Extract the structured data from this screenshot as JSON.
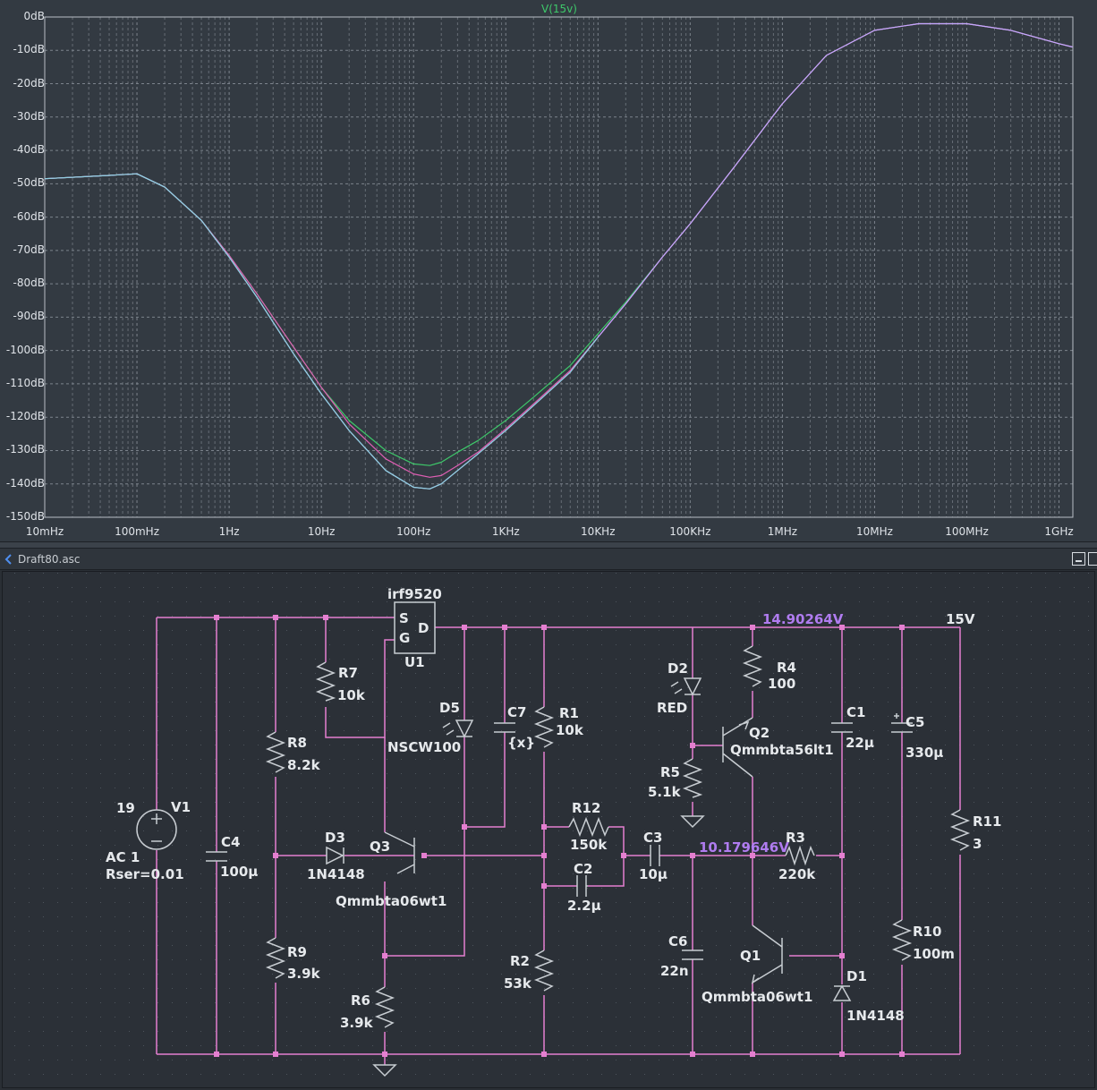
{
  "plot": {
    "trace_label": "V(15v)",
    "trace_color": "#3ec86a",
    "y_axis": {
      "ticks": [
        "0dB",
        "-10dB",
        "-20dB",
        "-30dB",
        "-40dB",
        "-50dB",
        "-60dB",
        "-70dB",
        "-80dB",
        "-90dB",
        "-100dB",
        "-110dB",
        "-120dB",
        "-130dB",
        "-140dB",
        "-150dB"
      ],
      "range_db": [
        -150,
        0
      ]
    },
    "x_axis": {
      "ticks": [
        "10mHz",
        "100mHz",
        "1Hz",
        "10Hz",
        "100Hz",
        "1KHz",
        "10KHz",
        "100KHz",
        "1MHz",
        "10MHz",
        "100MHz",
        "1GHz"
      ],
      "range_log10_hz": [
        -2,
        9.15
      ],
      "scale": "log"
    },
    "grid": true,
    "background": "#333a42",
    "grid_color": "#7c838c"
  },
  "chart_data": {
    "type": "line",
    "title": "",
    "xlabel": "",
    "ylabel": "",
    "x_scale": "log",
    "x_unit": "Hz",
    "y_unit": "dB",
    "ylim": [
      -150,
      0
    ],
    "xlim": [
      0.01,
      1400000000
    ],
    "grid": true,
    "series": [
      {
        "name": "V(15v)",
        "color": "#3ec86a",
        "x": [
          0.01,
          0.05,
          0.1,
          0.2,
          0.5,
          1,
          2,
          5,
          10,
          20,
          50,
          100,
          150,
          200,
          300,
          500,
          1000,
          2000,
          5000,
          10000,
          20000,
          50000,
          100000,
          300000,
          1000000,
          3000000,
          10000000,
          30000000,
          100000000,
          300000000,
          1000000000,
          1400000000
        ],
        "y": [
          -48.5,
          -47.5,
          -47,
          -51,
          -61,
          -71.5,
          -83,
          -99,
          -111,
          -121,
          -130,
          -134,
          -134.5,
          -133.5,
          -130.5,
          -127,
          -121,
          -114,
          -104.5,
          -95,
          -85.5,
          -72,
          -62,
          -45,
          -26,
          -11.5,
          -4,
          -2,
          -2,
          -4,
          -8,
          -9
        ]
      },
      {
        "name": "",
        "color": "#e05fb4",
        "x": [
          0.01,
          0.05,
          0.1,
          0.2,
          0.5,
          1,
          2,
          5,
          10,
          20,
          50,
          100,
          150,
          200,
          300,
          500,
          1000,
          2000,
          5000,
          10000,
          20000,
          50000,
          100000,
          300000,
          1000000,
          3000000,
          10000000,
          30000000,
          100000000,
          300000000,
          1000000000,
          1400000000
        ],
        "y": [
          -48.5,
          -47.5,
          -47,
          -51,
          -61,
          -71.5,
          -83,
          -99,
          -111,
          -122,
          -132.5,
          -137,
          -138,
          -137.5,
          -134.5,
          -130.5,
          -123.5,
          -116,
          -106,
          -96,
          -86,
          -72,
          -62,
          -45,
          -26,
          -11.5,
          -4,
          -2,
          -2,
          -4,
          -8,
          -9
        ]
      },
      {
        "name": "",
        "color": "#c4a6ff",
        "x": [
          0.01,
          0.05,
          0.1,
          0.2,
          0.5,
          1,
          2,
          5,
          10,
          20,
          50,
          100,
          150,
          200,
          300,
          500,
          1000,
          2000,
          5000,
          10000,
          20000,
          50000,
          100000,
          300000,
          1000000,
          3000000,
          10000000,
          30000000,
          100000000,
          300000000,
          1000000000,
          1400000000
        ],
        "y": [
          -48.5,
          -47.5,
          -47,
          -51,
          -61,
          -72,
          -84,
          -101,
          -113,
          -124,
          -136,
          -141,
          -141.5,
          -140,
          -136,
          -131,
          -124,
          -116.5,
          -106.5,
          -96,
          -86,
          -72,
          -62,
          -45,
          -26,
          -11.5,
          -4,
          -2,
          -2,
          -4,
          -8,
          -9
        ]
      },
      {
        "name": "",
        "color": "#8fd0e0",
        "x": [
          0.01,
          0.05,
          0.1,
          0.2,
          0.5,
          1,
          2,
          5,
          10,
          20,
          50,
          100,
          150,
          200,
          300,
          500,
          1000,
          2000,
          5000,
          10000
        ],
        "y": [
          -48.5,
          -47.5,
          -47,
          -51,
          -61,
          -72,
          -84,
          -101,
          -113,
          -124,
          -136,
          -141,
          -141.5,
          -140,
          -136,
          -131,
          -124,
          -116.5,
          -106.5,
          -96
        ]
      }
    ]
  },
  "schematic": {
    "window_title": "Draft80.asc",
    "wire_color": "#e47fd0",
    "component_color": "#c8cdd2",
    "labels": {
      "u1_model": "irf9520",
      "u1_ref": "U1",
      "u1_pin_s": "S",
      "u1_pin_g": "G",
      "u1_pin_d": "D",
      "node_top": "14.90264V",
      "node_15v": "15V",
      "node_mid": "10.179646V",
      "d2_ref": "D2",
      "d2_val": "RED",
      "r4_ref": "R4",
      "r4_val": "100",
      "q2_ref": "Q2",
      "q2_val": "Qmmbta56lt1",
      "c1_ref": "C1",
      "c1_val": "22µ",
      "c5_ref": "C5",
      "c5_val": "330µ",
      "r5_ref": "R5",
      "r5_val": "5.1k",
      "r7_ref": "R7",
      "r7_val": "10k",
      "d5_ref": "D5",
      "d5_val": "NSCW100",
      "c7_ref": "C7",
      "c7_val": "{x}",
      "r1_ref": "R1",
      "r1_val": "10k",
      "r8_ref": "R8",
      "r8_val": "8.2k",
      "v1_ref": "V1",
      "v1_dc": "19",
      "v1_ac": "AC 1",
      "v1_rser": "Rser=0.01",
      "c4_ref": "C4",
      "c4_val": "100µ",
      "d3_ref": "D3",
      "d3_val": "1N4148",
      "q3_ref": "Q3",
      "q3_val": "Qmmbta06wt1",
      "r12_ref": "R12",
      "r12_val": "150k",
      "c3_ref": "C3",
      "c3_val": "10µ",
      "r3_ref": "R3",
      "r3_val": "220k",
      "r11_ref": "R11",
      "r11_val": "3",
      "c2_ref": "C2",
      "c2_val": "2.2µ",
      "r9_ref": "R9",
      "r9_val": "3.9k",
      "r6_ref": "R6",
      "r6_val": "3.9k",
      "r2_ref": "R2",
      "r2_val": "53k",
      "c6_ref": "C6",
      "c6_val": "22n",
      "q1_ref": "Q1",
      "q1_val": "Qmmbta06wt1",
      "d1_ref": "D1",
      "d1_val": "1N4148",
      "r10_ref": "R10",
      "r10_val": "100m"
    }
  }
}
